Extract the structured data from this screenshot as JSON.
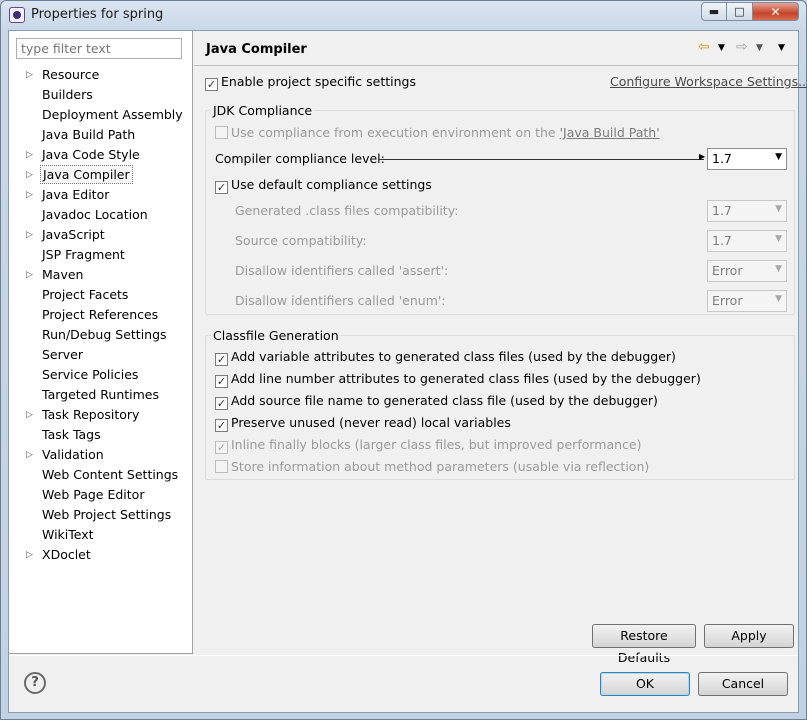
{
  "window": {
    "title": "Properties for spring"
  },
  "filter": {
    "placeholder": "type filter text"
  },
  "tree": [
    {
      "label": "Resource",
      "expandable": true
    },
    {
      "label": "Builders",
      "expandable": false
    },
    {
      "label": "Deployment Assembly",
      "expandable": false
    },
    {
      "label": "Java Build Path",
      "expandable": false
    },
    {
      "label": "Java Code Style",
      "expandable": true
    },
    {
      "label": "Java Compiler",
      "expandable": true,
      "selected": true
    },
    {
      "label": "Java Editor",
      "expandable": true
    },
    {
      "label": "Javadoc Location",
      "expandable": false
    },
    {
      "label": "JavaScript",
      "expandable": true
    },
    {
      "label": "JSP Fragment",
      "expandable": false
    },
    {
      "label": "Maven",
      "expandable": true
    },
    {
      "label": "Project Facets",
      "expandable": false
    },
    {
      "label": "Project References",
      "expandable": false
    },
    {
      "label": "Run/Debug Settings",
      "expandable": false
    },
    {
      "label": "Server",
      "expandable": false
    },
    {
      "label": "Service Policies",
      "expandable": false
    },
    {
      "label": "Targeted Runtimes",
      "expandable": false
    },
    {
      "label": "Task Repository",
      "expandable": true
    },
    {
      "label": "Task Tags",
      "expandable": false
    },
    {
      "label": "Validation",
      "expandable": true
    },
    {
      "label": "Web Content Settings",
      "expandable": false
    },
    {
      "label": "Web Page Editor",
      "expandable": false
    },
    {
      "label": "Web Project Settings",
      "expandable": false
    },
    {
      "label": "WikiText",
      "expandable": false
    },
    {
      "label": "XDoclet",
      "expandable": true
    }
  ],
  "page": {
    "title": "Java Compiler",
    "enable_specific": {
      "label": "Enable project specific settings",
      "checked": true
    },
    "configure_link": "Configure Workspace Settings...",
    "jdk": {
      "group_title": "JDK Compliance",
      "use_env_prefix": "Use compliance from execution environment on the ",
      "use_env_link": "'Java Build Path'",
      "compliance_label": "Compiler compliance level:",
      "compliance_value": "1.7",
      "use_default": {
        "label": "Use default compliance settings",
        "checked": true
      },
      "generated_label": "Generated .class files compatibility:",
      "generated_value": "1.7",
      "source_label": "Source compatibility:",
      "source_value": "1.7",
      "assert_label": "Disallow identifiers called 'assert':",
      "assert_value": "Error",
      "enum_label": "Disallow identifiers called 'enum':",
      "enum_value": "Error"
    },
    "classfile": {
      "group_title": "Classfile Generation",
      "options": [
        {
          "label": "Add variable attributes to generated class files (used by the debugger)",
          "checked": true,
          "enabled": true
        },
        {
          "label": "Add line number attributes to generated class files (used by the debugger)",
          "checked": true,
          "enabled": true
        },
        {
          "label": "Add source file name to generated class file (used by the debugger)",
          "checked": true,
          "enabled": true
        },
        {
          "label": "Preserve unused (never read) local variables",
          "checked": true,
          "enabled": true
        },
        {
          "label": "Inline finally blocks (larger class files, but improved performance)",
          "checked": true,
          "enabled": false
        },
        {
          "label": "Store information about method parameters (usable via reflection)",
          "checked": false,
          "enabled": false
        }
      ]
    },
    "restore_defaults": "Restore Defaults",
    "apply": "Apply"
  },
  "footer": {
    "help": "?",
    "ok": "OK",
    "cancel": "Cancel"
  },
  "icons": {
    "back": "back-arrow-icon",
    "forward": "forward-arrow-icon",
    "menu": "view-menu-icon"
  }
}
